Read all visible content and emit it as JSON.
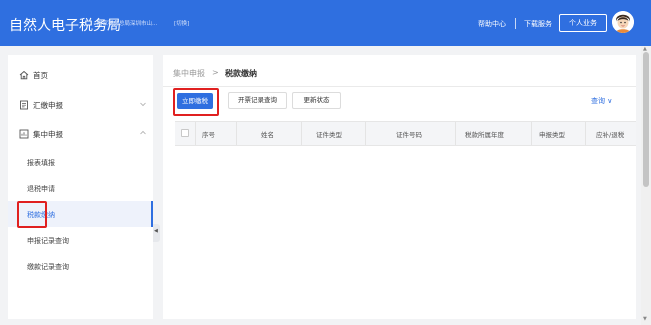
{
  "header": {
    "title": "自然人电子税务局",
    "region": "国家税务总局深圳市山...",
    "switch_label": "[切换]",
    "help_label": "帮助中心",
    "download_label": "下载服务",
    "personal_label": "个人业务"
  },
  "sidebar": {
    "home": {
      "label": "首页",
      "icon": "home-icon"
    },
    "summary": {
      "label": "汇缴申报",
      "icon": "document-icon"
    },
    "centralized": {
      "label": "集中申报",
      "icon": "report-icon"
    },
    "sub_items": [
      {
        "label": "报表填报"
      },
      {
        "label": "退税申请"
      },
      {
        "label": "税款缴纳"
      },
      {
        "label": "申报记录查询"
      },
      {
        "label": "缴款记录查询"
      }
    ]
  },
  "main": {
    "breadcrumb": {
      "parent": "集中申报",
      "separator": ">",
      "current": "税款缴纳"
    },
    "toolbar": {
      "pay_now": "立即缴税",
      "invoice_query": "开票记录查询",
      "update_status": "更新状态",
      "query": "查询 ∨"
    },
    "table": {
      "headers": [
        "序号",
        "姓名",
        "证件类型",
        "证件号码",
        "税款所属年度",
        "申报类型",
        "应补/退税"
      ]
    }
  },
  "colors": {
    "brand": "#2f6fe0",
    "highlight": "#e02020"
  }
}
